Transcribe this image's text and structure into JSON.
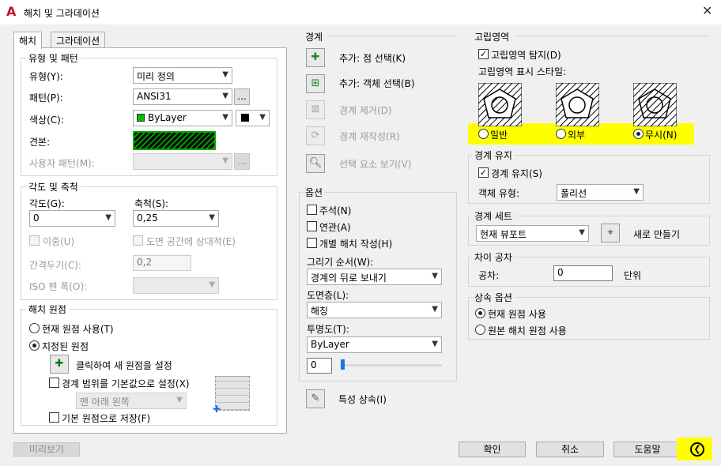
{
  "window": {
    "title": "해치 및 그라데이션",
    "close_symbol": "✕"
  },
  "tabs": [
    {
      "label": "해치"
    },
    {
      "label": "그라데이션"
    }
  ],
  "type_pattern": {
    "title": "유형 및 패턴",
    "type_label": "유형(Y):",
    "type_value": "미리 정의",
    "pattern_label": "패턴(P):",
    "pattern_value": "ANSI31",
    "pattern_browse": "...",
    "color_label": "색상(C):",
    "color_value": "ByLayer",
    "color_swatch": "#00c000",
    "sample_label": "견본:",
    "custom_label": "사용자 패턴(M):",
    "custom_browse": "..."
  },
  "angle_scale": {
    "title": "각도 및 축척",
    "angle_label": "각도(G):",
    "angle_value": "0",
    "scale_label": "축척(S):",
    "scale_value": "0,25",
    "double_label": "이중(U)",
    "paperspace_label": "도면 공간에 상대적(E)",
    "spacing_label": "간격두기(C):",
    "spacing_value": "0,2",
    "iso_label": "ISO 펜 폭(O):"
  },
  "origin": {
    "title": "해치 원점",
    "current_label": "현재 원점 사용(T)",
    "specified_label": "지정된 원점",
    "click_label": "클릭하여 새 원점을 설정",
    "default_extents_label": "경계 범위를 기본값으로 설정(X)",
    "position_value": "맨 아래 왼쪽",
    "store_label": "기본 원점으로 저장(F)"
  },
  "boundaries": {
    "title": "경계",
    "add_pick": "추가: 점 선택(K)",
    "add_select": "추가: 객체 선택(B)",
    "remove": "경계 제거(D)",
    "recreate": "경계 재작성(R)",
    "view": "선택 요소 보기(V)"
  },
  "options": {
    "title": "옵션",
    "annotative": "주석(N)",
    "associative": "연관(A)",
    "separate": "개별 해치 작성(H)",
    "draw_order_label": "그리기 순서(W):",
    "draw_order_value": "경계의 뒤로 보내기",
    "layer_label": "도면층(L):",
    "layer_value": "해칭",
    "transparency_label": "투명도(T):",
    "transparency_value": "ByLayer",
    "transparency_amount": "0"
  },
  "inherit_props": {
    "label": "특성 상속(I)"
  },
  "islands": {
    "title": "고립영역",
    "detect_label": "고립영역 탐지(D)",
    "style_label": "고립영역 표시 스타일:",
    "styles": [
      {
        "label": "일반"
      },
      {
        "label": "외부"
      },
      {
        "label": "무시(N)"
      }
    ],
    "highlight_color": "#ffff00"
  },
  "retain": {
    "title": "경계 유지",
    "retain_label": "경계 유지(S)",
    "object_type_label": "객체 유형:",
    "object_type_value": "폴리선"
  },
  "boundary_set": {
    "title": "경계 세트",
    "value": "현재 뷰포트",
    "new_label": "새로 만들기"
  },
  "gap": {
    "title": "차이 공차",
    "label": "공차:",
    "value": "0",
    "unit": "단위"
  },
  "inherit_options": {
    "title": "상속 옵션",
    "current_label": "현재 원점 사용",
    "source_label": "원본 해치 원점 사용"
  },
  "footer": {
    "preview": "미리보기",
    "ok": "확인",
    "cancel": "취소",
    "help": "도움말"
  }
}
